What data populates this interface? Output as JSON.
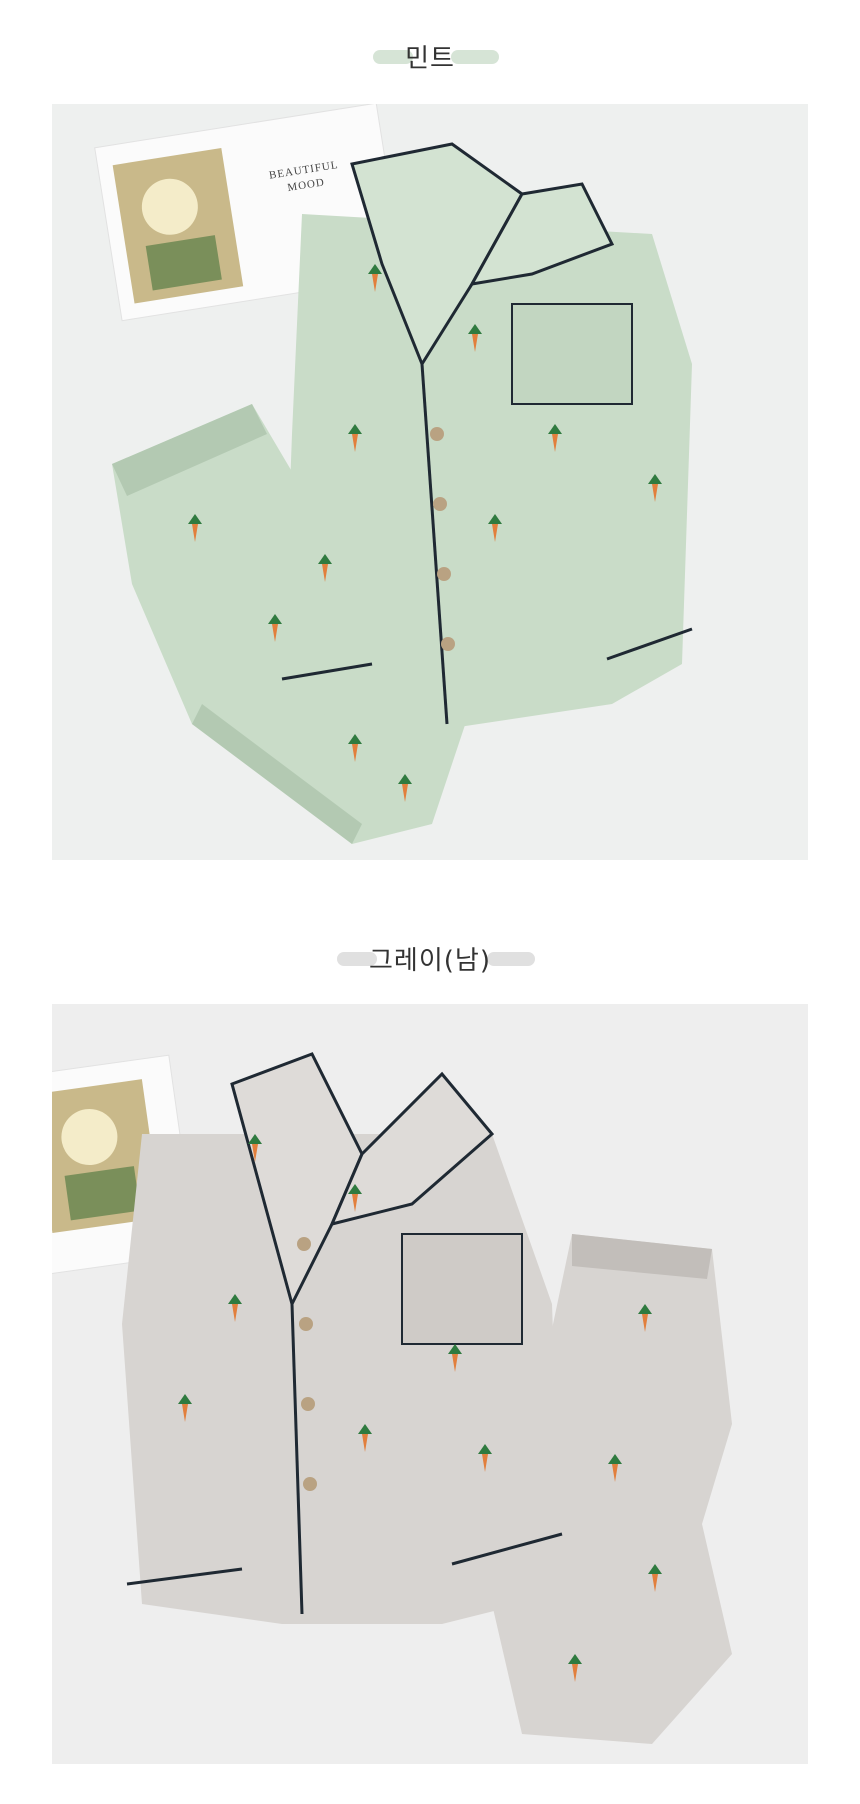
{
  "sections": [
    {
      "title": "민트",
      "color_name": "mint",
      "accent_color": "#c6d8c6",
      "background_color": "#eef0ef",
      "fabric_color": "#c9dcc8",
      "fabric_shade": "#b3c9b2",
      "card_text": "BEAUTIFUL\nMOOD"
    },
    {
      "title": "그레이(남)",
      "color_name": "gray",
      "accent_color": "#d4d4d4",
      "background_color": "#eeeeee",
      "fabric_color": "#d7d4d1",
      "fabric_shade": "#c2beba"
    }
  ],
  "colors": {
    "piping": "#1f2933",
    "carrot": "#e27f3c",
    "leaf": "#2f7a3f",
    "button": "#b9a282"
  }
}
